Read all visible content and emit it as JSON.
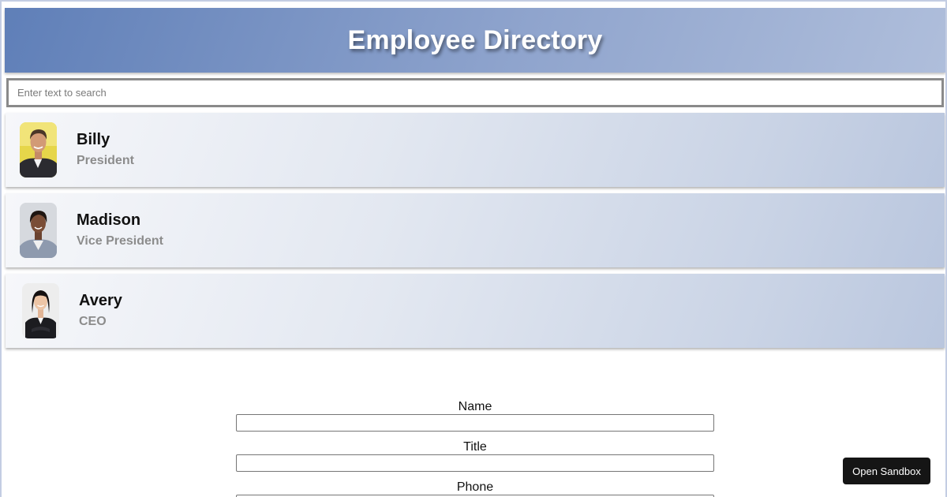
{
  "header": {
    "title": "Employee Directory"
  },
  "search": {
    "placeholder": "Enter text to search",
    "value": ""
  },
  "employees": [
    {
      "name": "Billy",
      "title": "President",
      "avatar": "avatar-photo-billy"
    },
    {
      "name": "Madison",
      "title": "Vice President",
      "avatar": "avatar-photo-madison"
    },
    {
      "name": "Avery",
      "title": "CEO",
      "avatar": "avatar-photo-avery"
    }
  ],
  "form": {
    "name_label": "Name",
    "title_label": "Title",
    "phone_label": "Phone"
  },
  "sandbox": {
    "label": "Open Sandbox"
  },
  "colors": {
    "header_start": "#5f7fb8",
    "header_end": "#afbedb",
    "card_start": "#f6f7fa",
    "card_end": "#b9c6de",
    "subtitle_gray": "#8c8c8c",
    "button_dark": "#151515"
  }
}
